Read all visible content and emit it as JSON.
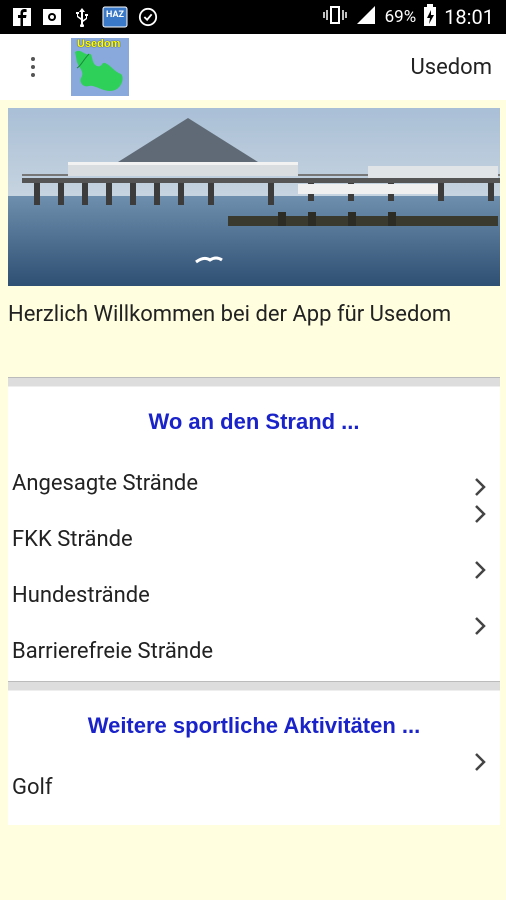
{
  "status": {
    "battery": "69%",
    "time": "18:01",
    "left_icons": [
      "facebook-icon",
      "photo-icon",
      "usb-icon",
      "haz-app-icon",
      "sync-icon"
    ],
    "right_icons": [
      "vibrate-icon",
      "signal-icon",
      "battery-icon"
    ],
    "haz_label": "HAZ"
  },
  "appbar": {
    "title": "Usedom",
    "logo_text": "Usedom"
  },
  "welcome": "Herzlich Willkommen bei der App für Usedom",
  "sections": [
    {
      "title": "Wo an den Strand ...",
      "items": [
        "Angesagte Strände",
        "FKK Strände",
        "Hundestrände",
        "Barrierefreie Strände"
      ]
    },
    {
      "title": "Weitere sportliche Aktivitäten ...",
      "items": [
        "Golf"
      ]
    }
  ],
  "colors": {
    "background": "#ffffe0",
    "section_title": "#1a23c9"
  }
}
